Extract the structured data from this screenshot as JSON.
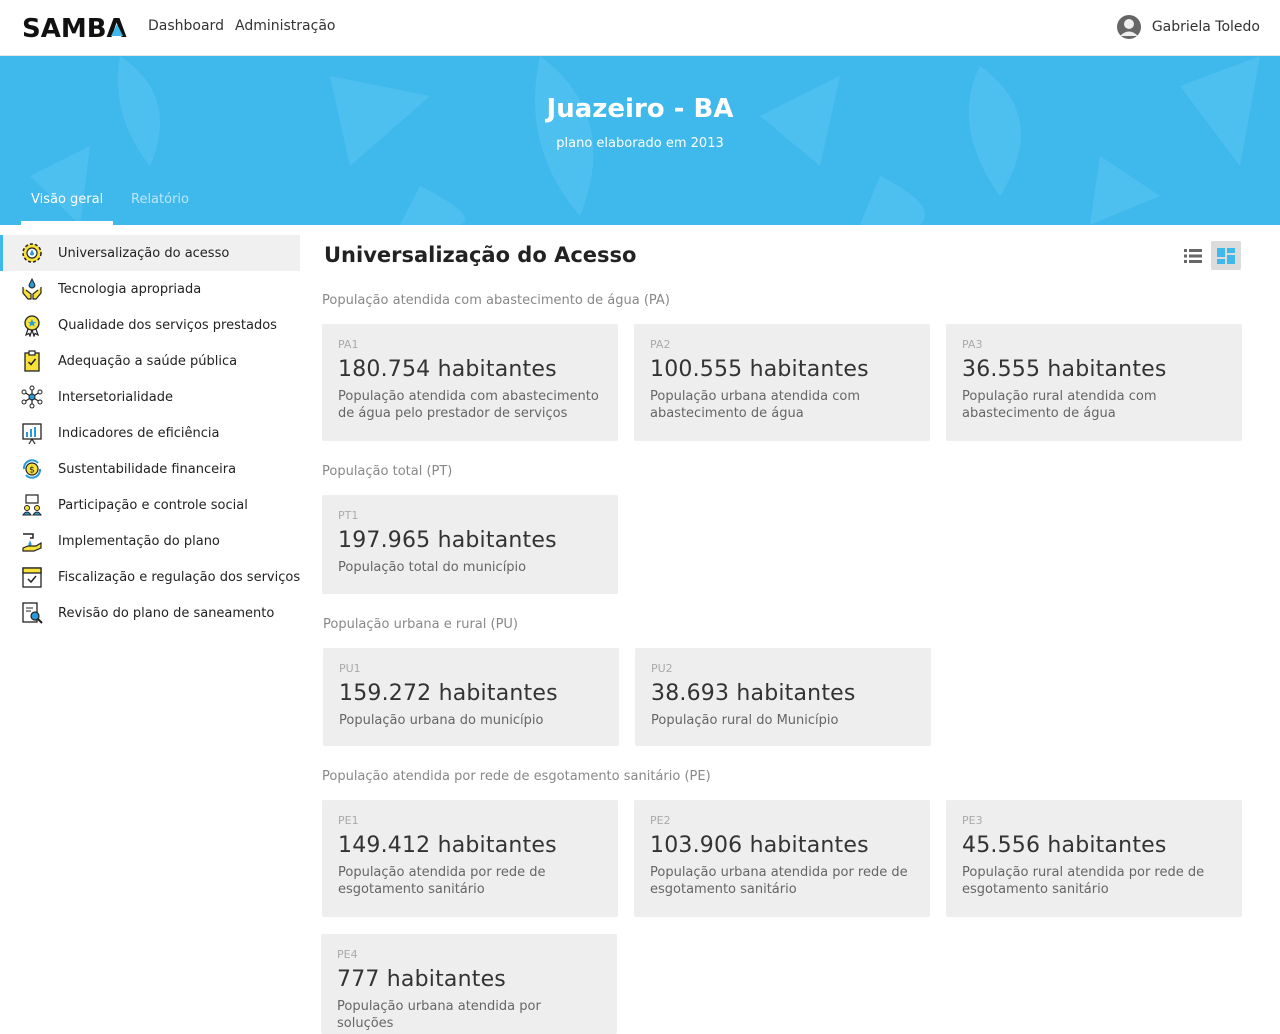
{
  "header": {
    "logo_text": "SAMBA",
    "nav": [
      "Dashboard",
      "Administração"
    ],
    "user_name": "Gabriela Toledo"
  },
  "hero": {
    "title": "Juazeiro - BA",
    "subtitle": "plano elaborado em 2013",
    "tabs": [
      "Visão geral",
      "Relatório"
    ]
  },
  "sidebar": {
    "items": [
      {
        "label": "Universalização do acesso",
        "icon": "gear-drop-icon"
      },
      {
        "label": "Tecnologia apropriada",
        "icon": "hands-drop-icon"
      },
      {
        "label": "Qualidade dos serviços prestados",
        "icon": "medal-icon"
      },
      {
        "label": "Adequação a saúde pública",
        "icon": "clipboard-icon"
      },
      {
        "label": "Intersetorialidade",
        "icon": "network-icon"
      },
      {
        "label": "Indicadores de eficiência",
        "icon": "chart-board-icon"
      },
      {
        "label": "Sustentabilidade financeira",
        "icon": "money-cycle-icon"
      },
      {
        "label": "Participação e controle social",
        "icon": "people-board-icon"
      },
      {
        "label": "Implementação do plano",
        "icon": "faucet-hand-icon"
      },
      {
        "label": "Fiscalização e regulação dos serviços",
        "icon": "checklist-icon"
      },
      {
        "label": "Revisão do plano de saneamento",
        "icon": "document-search-icon"
      }
    ]
  },
  "main": {
    "title": "Universalização do Acesso",
    "sections": [
      {
        "label": "População atendida com abastecimento de água (PA)"
      },
      {
        "label": "População total (PT)"
      },
      {
        "label": "População urbana e rural (PU)"
      },
      {
        "label": "População atendida por rede de esgotamento sanitário (PE)"
      }
    ],
    "cards": [
      {
        "code": "PA1",
        "value": "180.754 habitantes",
        "desc": "População atendida com abastecimento de água pelo prestador de serviços"
      },
      {
        "code": "PA2",
        "value": "100.555 habitantes",
        "desc": "População urbana atendida com abastecimento de água"
      },
      {
        "code": "PA3",
        "value": "36.555 habitantes",
        "desc": "População rural atendida com abastecimento de água"
      },
      {
        "code": "PT1",
        "value": "197.965 habitantes",
        "desc": "População total do município"
      },
      {
        "code": "PU1",
        "value": "159.272 habitantes",
        "desc": "População urbana do município"
      },
      {
        "code": "PU2",
        "value": "38.693 habitantes",
        "desc": "População rural do Município"
      },
      {
        "code": "PE1",
        "value": "149.412 habitantes",
        "desc": "População atendida por rede de esgotamento sanitário"
      },
      {
        "code": "PE2",
        "value": "103.906 habitantes",
        "desc": "População urbana atendida por rede de esgotamento sanitário"
      },
      {
        "code": "PE3",
        "value": "45.556 habitantes",
        "desc": "População rural atendida por rede de esgotamento sanitário"
      },
      {
        "code": "PE4",
        "value": "777 habitantes",
        "desc": "População urbana atendida por soluções"
      }
    ]
  },
  "colors": {
    "accent": "#3fb8ec",
    "card_bg": "#eeeeee",
    "icon_yellow": "#f6e23a",
    "icon_blue": "#2a9ad6"
  }
}
